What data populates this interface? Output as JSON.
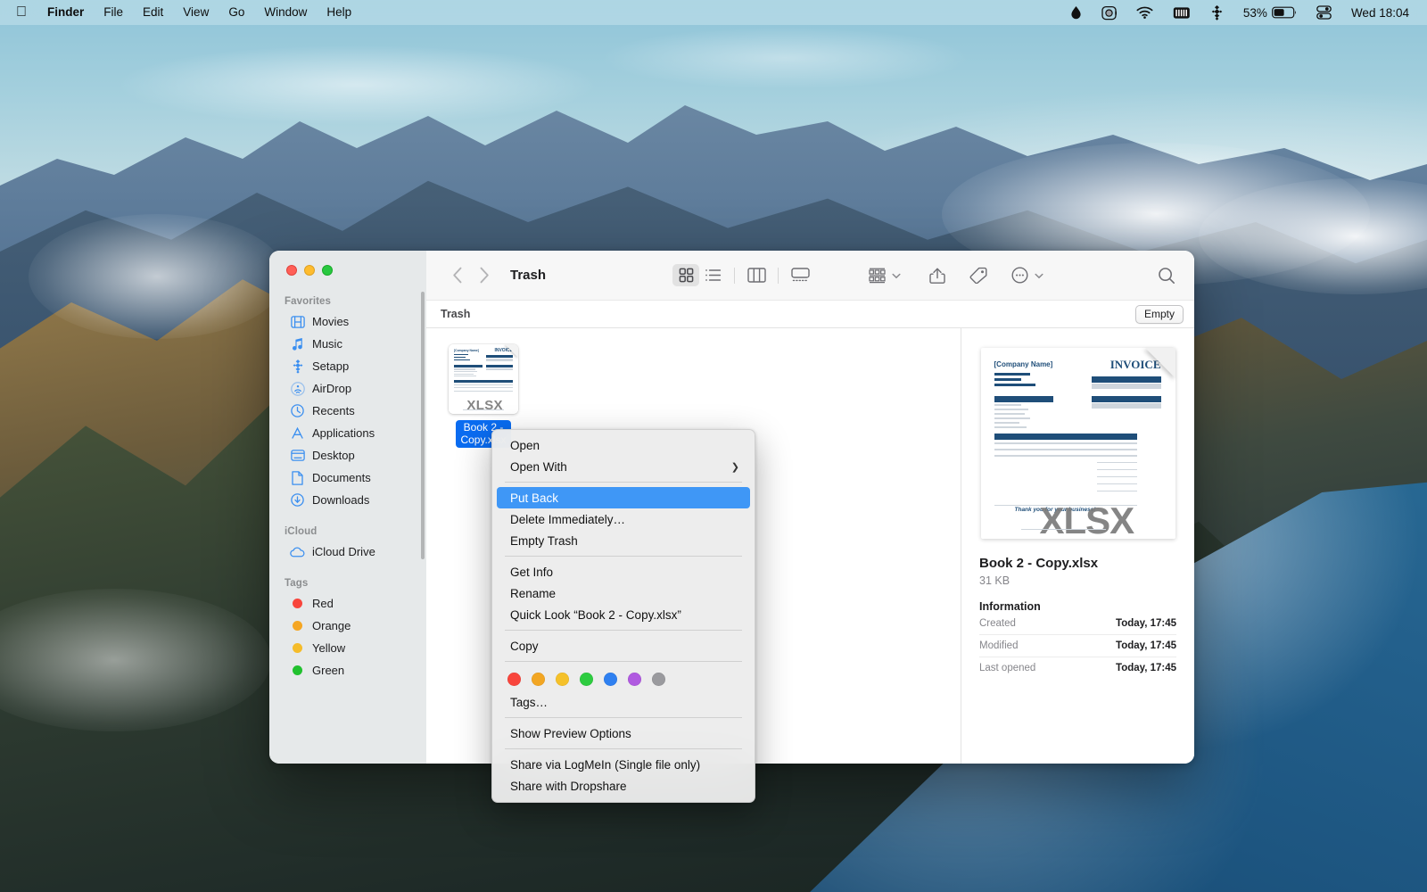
{
  "menubar": {
    "apple_icon": "apple-logo-icon",
    "items": [
      {
        "label": "Finder",
        "bold": true
      },
      {
        "label": "File",
        "bold": false
      },
      {
        "label": "Edit",
        "bold": false
      },
      {
        "label": "View",
        "bold": false
      },
      {
        "label": "Go",
        "bold": false
      },
      {
        "label": "Window",
        "bold": false
      },
      {
        "label": "Help",
        "bold": false
      }
    ],
    "status_icons": [
      "droplet-icon",
      "camera-icon",
      "wifi-icon",
      "battery-health-icon",
      "setapp-icon"
    ],
    "battery_percent": "53%",
    "control_center_icon": "control-center-icon",
    "clock": "Wed 18:04"
  },
  "window": {
    "title": "Trash",
    "traffic_lights": [
      "close-button",
      "minimize-button",
      "zoom-button"
    ],
    "toolbar": {
      "back_label": "Back",
      "forward_label": "Forward",
      "view_icon_grid": "icon-view-icon",
      "view_list": "list-view-icon",
      "view_column": "column-view-icon",
      "view_gallery": "gallery-view-icon",
      "group_label": "group-by-icon",
      "share_label": "share-icon",
      "tags_label": "tag-icon",
      "actions_label": "more-actions-icon",
      "search_label": "search-icon"
    },
    "pathbar": {
      "path": "Trash",
      "empty_button": "Empty"
    }
  },
  "sidebar": {
    "sections": [
      {
        "title": "Favorites",
        "items": [
          {
            "label": "Movies",
            "icon": "film-icon"
          },
          {
            "label": "Music",
            "icon": "music-note-icon"
          },
          {
            "label": "Setapp",
            "icon": "setapp-icon"
          },
          {
            "label": "AirDrop",
            "icon": "airdrop-icon"
          },
          {
            "label": "Recents",
            "icon": "clock-icon"
          },
          {
            "label": "Applications",
            "icon": "applications-icon"
          },
          {
            "label": "Desktop",
            "icon": "desktop-icon"
          },
          {
            "label": "Documents",
            "icon": "document-icon"
          },
          {
            "label": "Downloads",
            "icon": "downloads-icon"
          }
        ]
      },
      {
        "title": "iCloud",
        "items": [
          {
            "label": "iCloud Drive",
            "icon": "cloud-icon"
          }
        ]
      },
      {
        "title": "Tags",
        "items": [
          {
            "label": "Red",
            "icon": "tag-dot-icon",
            "color": "#f8453c"
          },
          {
            "label": "Orange",
            "icon": "tag-dot-icon",
            "color": "#f5a623"
          },
          {
            "label": "Yellow",
            "icon": "tag-dot-icon",
            "color": "#f5bc2a"
          },
          {
            "label": "Green",
            "icon": "tag-dot-icon",
            "color": "#21c12f"
          }
        ]
      }
    ]
  },
  "files": [
    {
      "name_line1": "Book 2 -",
      "name_line2": "Copy.xlsx",
      "selected": true,
      "thumb_type": "xlsx-invoice"
    }
  ],
  "context_menu": {
    "groups": [
      [
        {
          "label": "Open",
          "submenu": false,
          "selected": false
        },
        {
          "label": "Open With",
          "submenu": true,
          "selected": false
        }
      ],
      [
        {
          "label": "Put Back",
          "submenu": false,
          "selected": true
        },
        {
          "label": "Delete Immediately…",
          "submenu": false,
          "selected": false
        },
        {
          "label": "Empty Trash",
          "submenu": false,
          "selected": false
        }
      ],
      [
        {
          "label": "Get Info",
          "submenu": false,
          "selected": false
        },
        {
          "label": "Rename",
          "submenu": false,
          "selected": false
        },
        {
          "label": "Quick Look “Book 2 - Copy.xlsx”",
          "submenu": false,
          "selected": false
        }
      ],
      [
        {
          "label": "Copy",
          "submenu": false,
          "selected": false
        }
      ]
    ],
    "tag_colors": [
      "#f8453c",
      "#f2a623",
      "#f5c12a",
      "#2ecc40",
      "#2f80f0",
      "#b05ae0",
      "#9a9a9e"
    ],
    "tags_label": "Tags…",
    "preview_options_label": "Show Preview Options",
    "share_items": [
      "Share via LogMeIn (Single file only)",
      "Share with Dropshare"
    ]
  },
  "preview": {
    "thumb_watermark": "XLSX",
    "invoice_title": "INVOICE",
    "company_placeholder": "[Company Name]",
    "file_name": "Book 2 - Copy.xlsx",
    "file_size": "31 KB",
    "information_heading": "Information",
    "rows": [
      {
        "key": "Created",
        "value": "Today, 17:45"
      },
      {
        "key": "Modified",
        "value": "Today, 17:45"
      },
      {
        "key": "Last opened",
        "value": "Today, 17:45"
      }
    ]
  },
  "colors": {
    "accent_blue": "#0a6cf1",
    "menu_highlight": "#3f97f6",
    "sidebar_icon_blue": "#3b8ff0",
    "menubar_tint": "#badde7"
  }
}
